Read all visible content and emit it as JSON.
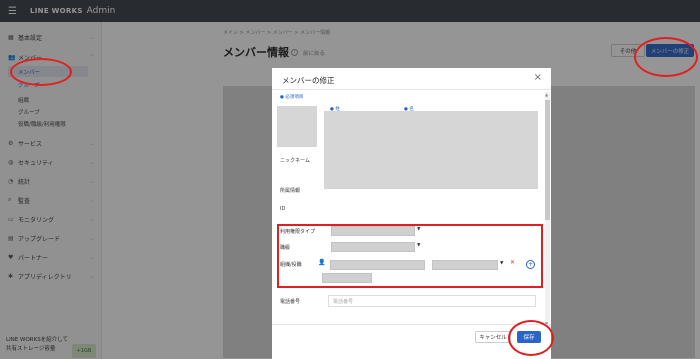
{
  "header": {
    "brand": "LINE WORKS",
    "brand_sub": "Admin"
  },
  "sidebar": {
    "items": [
      {
        "label": "基本設定",
        "icon": "building-icon"
      },
      {
        "label": "メンバー",
        "icon": "people-icon"
      },
      {
        "label": "サービス",
        "icon": "gear-icon"
      },
      {
        "label": "セキュリティ",
        "icon": "globe-icon"
      },
      {
        "label": "統計",
        "icon": "chart-icon"
      },
      {
        "label": "監査",
        "icon": "search-icon"
      },
      {
        "label": "モニタリング",
        "icon": "monitor-icon"
      },
      {
        "label": "アップグレード",
        "icon": "upgrade-icon"
      },
      {
        "label": "パートナー",
        "icon": "handshake-icon"
      },
      {
        "label": "アプリディレクトリ",
        "icon": "apps-icon"
      }
    ],
    "member_sub": [
      "メンバー",
      "グループ",
      "組織",
      "グループ",
      "役職/職級/利用権限"
    ],
    "promo_line1": "LINE WORKSを紹介して",
    "promo_line2": "共有ストレージ容量",
    "promo_badge": "+1GB"
  },
  "main": {
    "breadcrumb": "メイン > メンバー > メンバー > メンバー情報",
    "title": "メンバー情報",
    "help_glyph": "?",
    "back_label": "前に戻る",
    "other_label": "その他",
    "edit_label": "メンバーの修正"
  },
  "modal": {
    "title": "メンバーの修正",
    "close_glyph": "×",
    "required_note": "● 必須項目",
    "last_name_label": "● 姓",
    "first_name_label": "● 名",
    "nickname_label": "ニックネーム",
    "affiliation_label": "所属情報",
    "id_label": "ID",
    "usage_type_label": "利用権限タイプ",
    "position_label": "職級",
    "org_label": "組織/役職",
    "phone_label": "電話番号",
    "phone_placeholder": "電話番号",
    "cancel_label": "キャンセル",
    "save_label": "保存"
  },
  "colors": {
    "topbar": "#3a3f48",
    "accent": "#2b64c8",
    "annotation": "#e02020"
  }
}
